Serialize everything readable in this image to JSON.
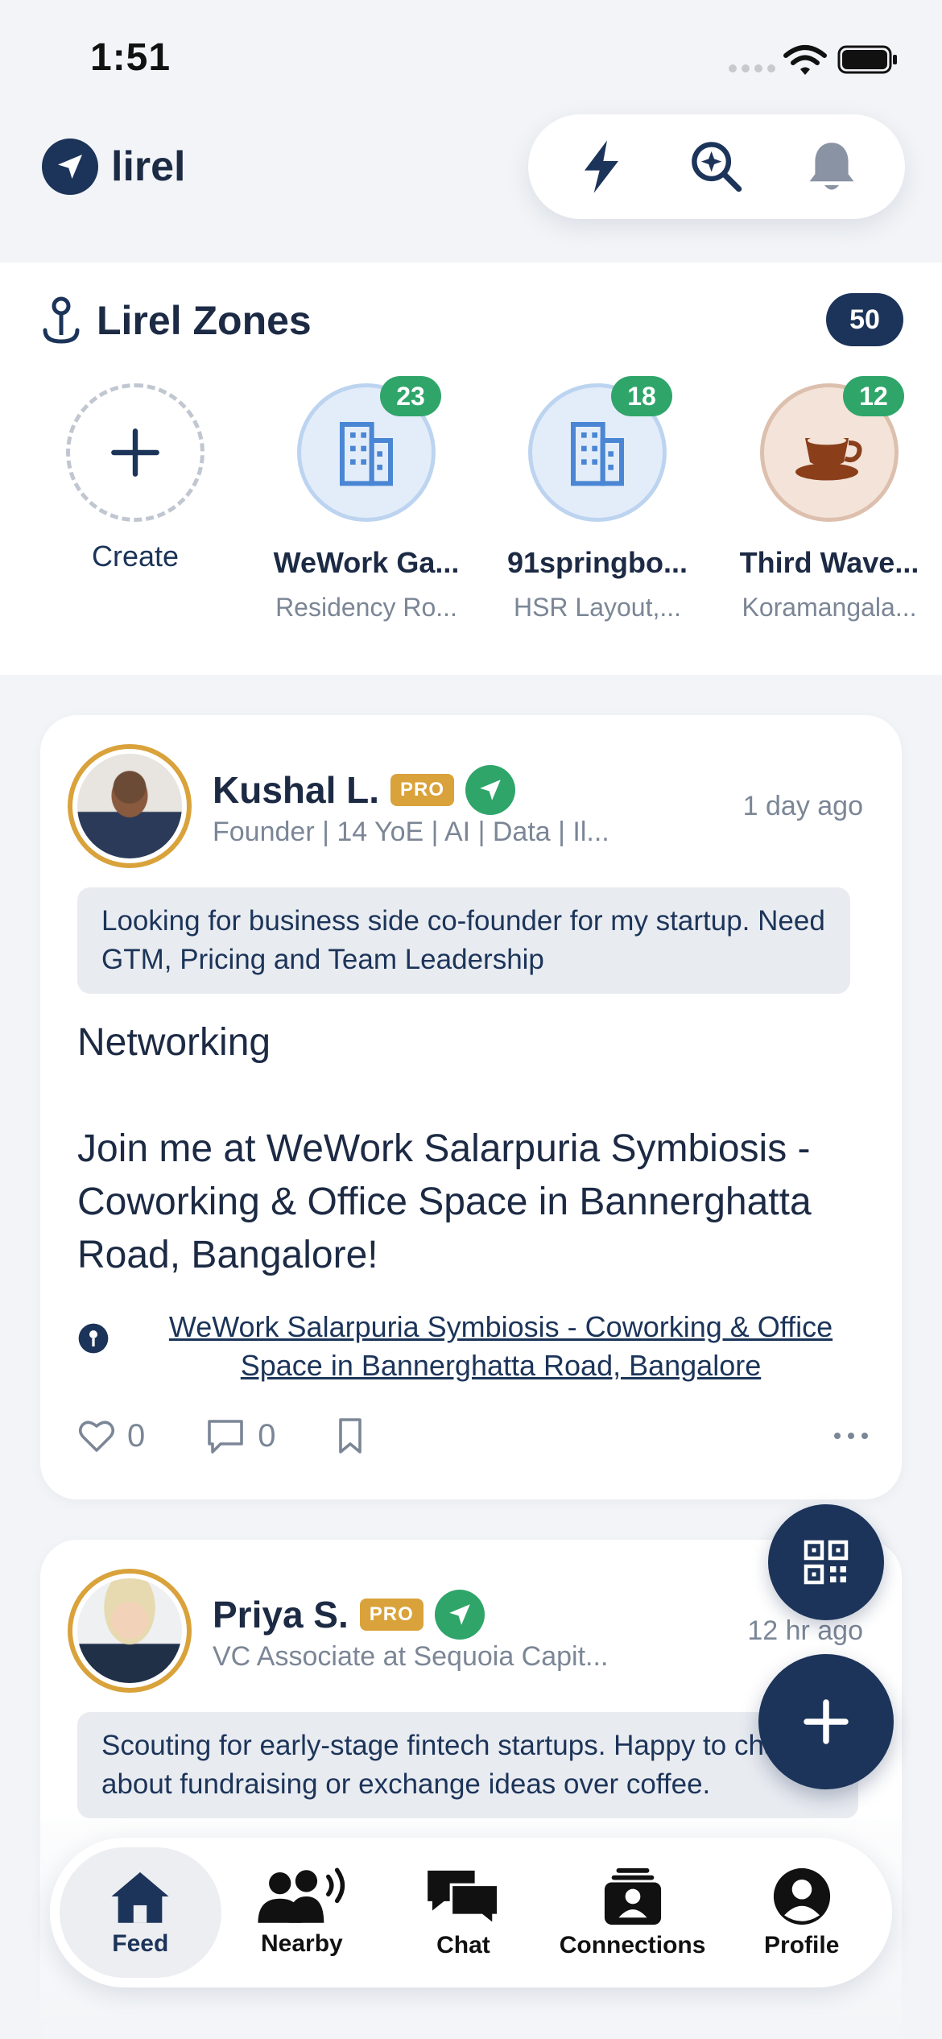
{
  "status_bar": {
    "time": "1:51"
  },
  "header": {
    "brand_name": "lirel",
    "actions": [
      "lightning-icon",
      "discover-search-icon",
      "bell-icon"
    ]
  },
  "zones": {
    "title": "Lirel Zones",
    "count": "50",
    "create_label": "Create",
    "items": [
      {
        "name": "WeWork Ga...",
        "subtitle": "Residency Ro...",
        "count": "23",
        "icon": "building-icon"
      },
      {
        "name": "91springbo...",
        "subtitle": "HSR Layout,...",
        "count": "18",
        "icon": "building-icon"
      },
      {
        "name": "Third Wave...",
        "subtitle": "Koramangala...",
        "count": "12",
        "icon": "coffee-icon"
      }
    ]
  },
  "feed": [
    {
      "name": "Kushal L.",
      "badge": "PRO",
      "headline": "Founder | 14 YoE | AI | Data | Il...",
      "time": "1 day ago",
      "intent": "Looking for business side co-founder for my startup. Need GTM, Pricing and Team Leadership",
      "body_line1": "Networking",
      "body_line2": "Join me at WeWork Salarpuria Symbiosis - Coworking & Office Space in Bannerghatta Road, Bangalore!",
      "location": "WeWork Salarpuria Symbiosis - Coworking & Office Space in Bannerghatta Road, Bangalore",
      "likes": "0",
      "comments": "0"
    },
    {
      "name": "Priya S.",
      "badge": "PRO",
      "headline": "VC Associate at Sequoia Capit...",
      "time": "12 hr ago",
      "intent": "Scouting for early-stage fintech startups. Happy to chat about fundraising or exchange ideas over coffee."
    }
  ],
  "tabs": [
    {
      "label": "Feed",
      "icon": "home-icon",
      "active": true
    },
    {
      "label": "Nearby",
      "icon": "nearby-people-icon",
      "active": false
    },
    {
      "label": "Chat",
      "icon": "chat-icon",
      "active": false
    },
    {
      "label": "Connections",
      "icon": "connections-icon",
      "active": false
    },
    {
      "label": "Profile",
      "icon": "profile-icon",
      "active": false
    }
  ],
  "colors": {
    "primary": "#1c3459",
    "accent_green": "#2fa56a",
    "pro_gold": "#d9a23a"
  }
}
